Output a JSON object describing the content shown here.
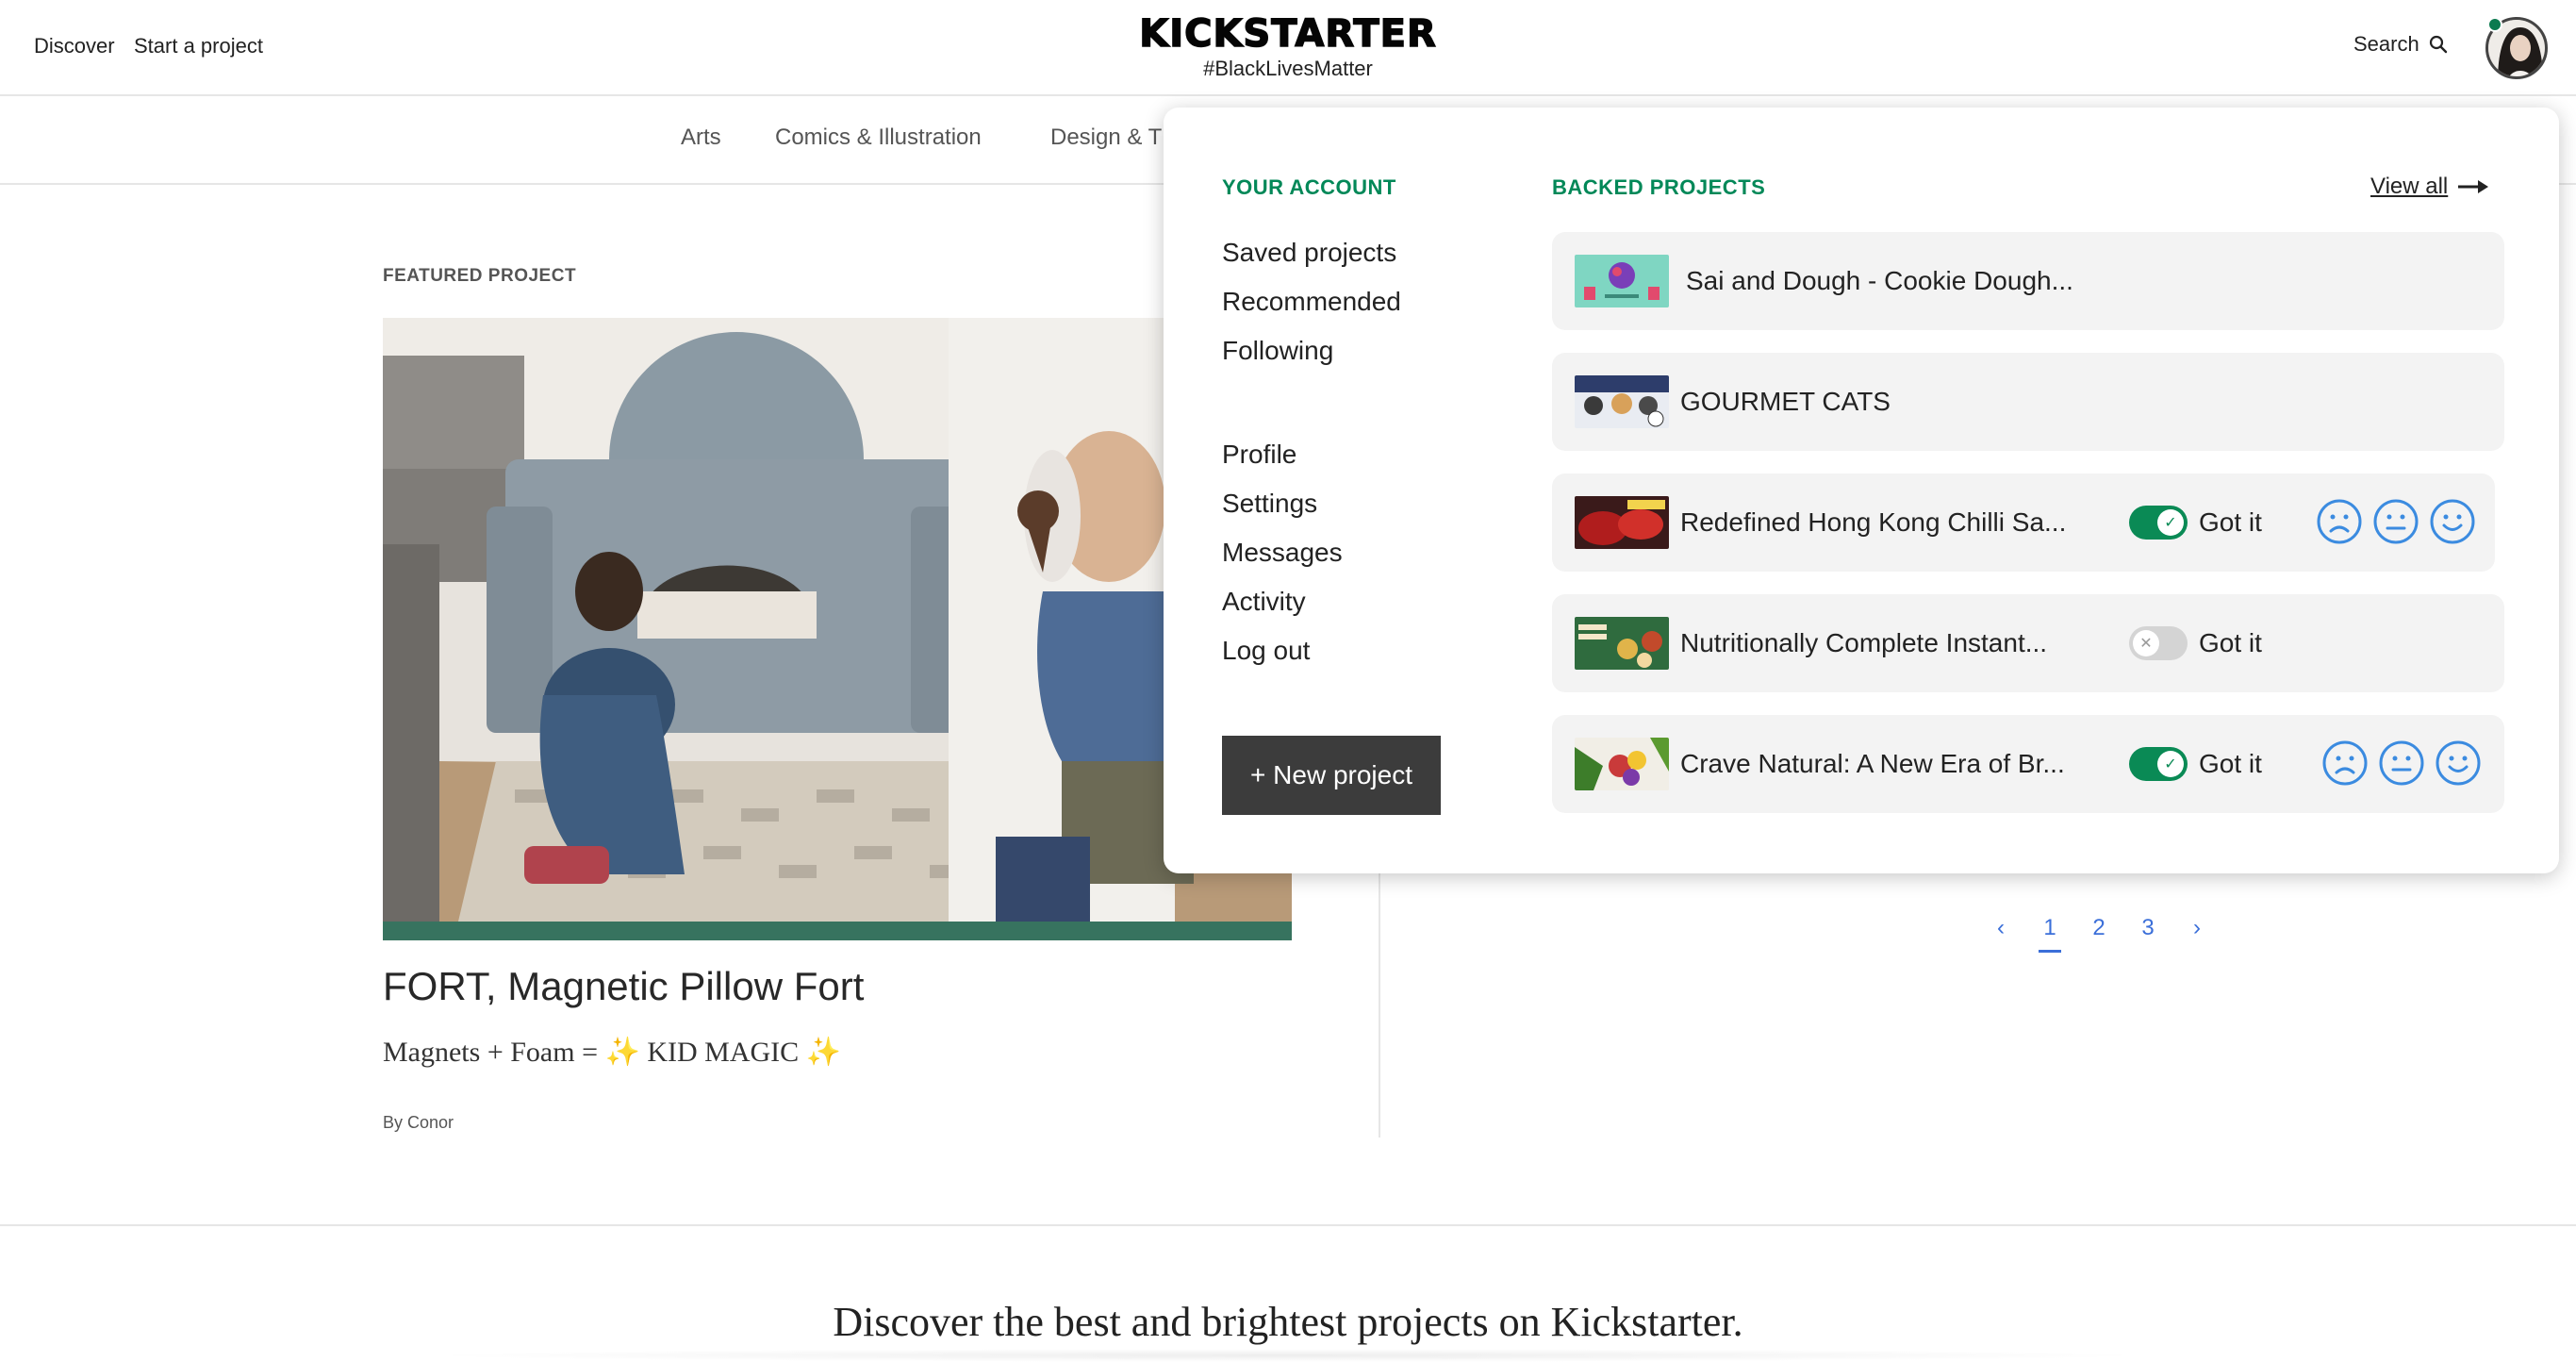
{
  "header": {
    "discover": "Discover",
    "start_project": "Start a project",
    "logo": "KICKSTARTER",
    "tagline": "#BlackLivesMatter",
    "search": "Search"
  },
  "categories": [
    "Arts",
    "Comics & Illustration",
    "Design & T"
  ],
  "featured": {
    "label": "FEATURED PROJECT",
    "title": "FORT, Magnetic Pillow Fort",
    "blurb": "Magnets + Foam = ✨ KID MAGIC ✨",
    "by": "By Conor",
    "progress": 1.0
  },
  "pagination": {
    "prev": "‹",
    "pages": [
      "1",
      "2",
      "3"
    ],
    "next": "›",
    "active": "1"
  },
  "footer": {
    "discover_heading": "Discover the best and brightest projects on Kickstarter."
  },
  "dropdown": {
    "your_account": "YOUR ACCOUNT",
    "account_links_top": [
      "Saved projects",
      "Recommended",
      "Following"
    ],
    "account_links_bottom": [
      "Profile",
      "Settings",
      "Messages",
      "Activity",
      "Log out"
    ],
    "new_project": "+ New project",
    "backed_projects": "BACKED PROJECTS",
    "view_all": "View all",
    "got_it": "Got it",
    "backed": [
      {
        "title": "Sai and Dough - Cookie Dough...",
        "toggle": null
      },
      {
        "title": "GOURMET CATS",
        "toggle": null
      },
      {
        "title": "Redefined Hong Kong Chilli Sa...",
        "toggle": "on"
      },
      {
        "title": "Nutritionally Complete Instant...",
        "toggle": "off"
      },
      {
        "title": "Crave Natural: A New Era of Br...",
        "toggle": "on"
      }
    ]
  },
  "colors": {
    "brand_green": "#028858",
    "toggle_on": "#0a8a55",
    "link_blue": "#3b6fd9",
    "progress": "#37735f",
    "face_blue": "#3b8be0"
  }
}
